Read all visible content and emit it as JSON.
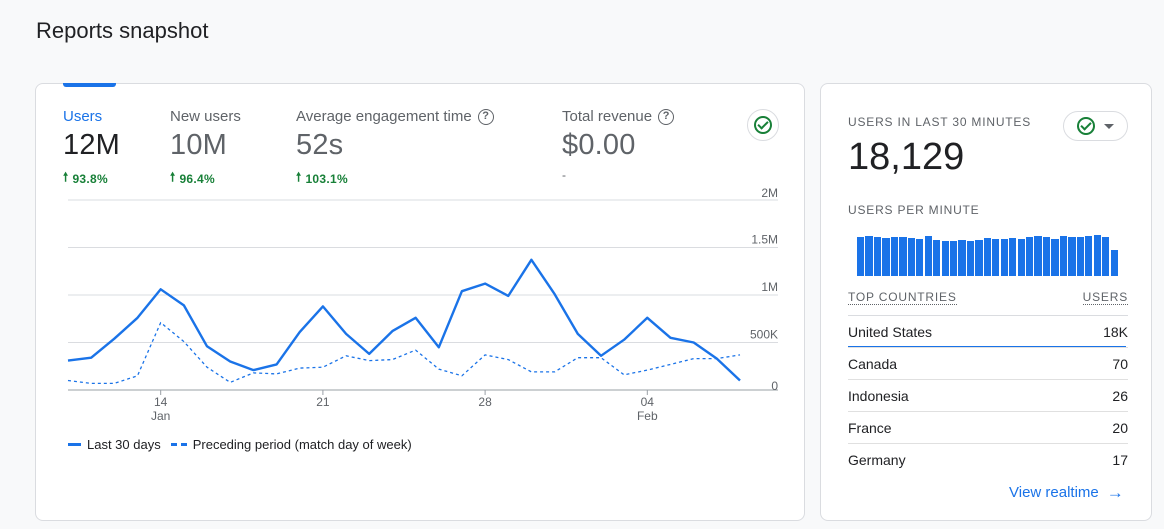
{
  "page": {
    "title": "Reports snapshot"
  },
  "metrics": [
    {
      "label": "Users",
      "value": "12M",
      "change": "93.8%",
      "help": false,
      "active": true
    },
    {
      "label": "New users",
      "value": "10M",
      "change": "96.4%",
      "help": false,
      "active": false
    },
    {
      "label": "Average engagement time",
      "value": "52s",
      "change": "103.1%",
      "help": true,
      "active": false
    },
    {
      "label": "Total revenue",
      "value": "$0.00",
      "change": "-",
      "help": true,
      "active": false
    }
  ],
  "chart_data": {
    "type": "line",
    "y_ticks": [
      "2M",
      "1.5M",
      "1M",
      "500K",
      "0"
    ],
    "ylim": [
      0,
      2000000
    ],
    "x_ticks": [
      {
        "day": "14",
        "month": "Jan",
        "index": 4
      },
      {
        "day": "21",
        "month": "",
        "index": 11
      },
      {
        "day": "28",
        "month": "",
        "index": 18
      },
      {
        "day": "04",
        "month": "Feb",
        "index": 25
      }
    ],
    "series": [
      {
        "name": "Last 30 days",
        "style": "solid",
        "values": [
          310000,
          340000,
          540000,
          760000,
          1060000,
          890000,
          460000,
          300000,
          210000,
          270000,
          610000,
          880000,
          590000,
          380000,
          620000,
          760000,
          450000,
          1040000,
          1120000,
          990000,
          1370000,
          1010000,
          590000,
          360000,
          530000,
          760000,
          550000,
          500000,
          330000,
          100000
        ]
      },
      {
        "name": "Preceding period (match day of week)",
        "style": "dashed",
        "values": [
          100000,
          70000,
          70000,
          150000,
          710000,
          510000,
          240000,
          80000,
          180000,
          170000,
          230000,
          240000,
          360000,
          310000,
          320000,
          420000,
          220000,
          150000,
          370000,
          320000,
          190000,
          190000,
          340000,
          340000,
          160000,
          210000,
          270000,
          330000,
          330000,
          370000
        ]
      }
    ],
    "legend": "bottom-left",
    "grid": true
  },
  "realtime": {
    "users_label": "USERS IN LAST 30 MINUTES",
    "users_value": "18,129",
    "per_minute_label": "USERS PER MINUTE",
    "per_minute": [
      0.92,
      0.95,
      0.93,
      0.9,
      0.93,
      0.92,
      0.9,
      0.88,
      0.95,
      0.86,
      0.83,
      0.83,
      0.86,
      0.83,
      0.86,
      0.9,
      0.88,
      0.88,
      0.9,
      0.88,
      0.92,
      0.95,
      0.93,
      0.88,
      0.95,
      0.92,
      0.93,
      0.95,
      0.97,
      0.93,
      0.62
    ],
    "countries_label": "TOP COUNTRIES",
    "users_col_label": "USERS",
    "countries": [
      {
        "name": "United States",
        "users": "18K"
      },
      {
        "name": "Canada",
        "users": "70"
      },
      {
        "name": "Indonesia",
        "users": "26"
      },
      {
        "name": "France",
        "users": "20"
      },
      {
        "name": "Germany",
        "users": "17"
      }
    ],
    "view_link": "View realtime"
  },
  "colors": {
    "accent": "#1a73e8",
    "positive": "#188038",
    "grid": "#dadce0"
  }
}
